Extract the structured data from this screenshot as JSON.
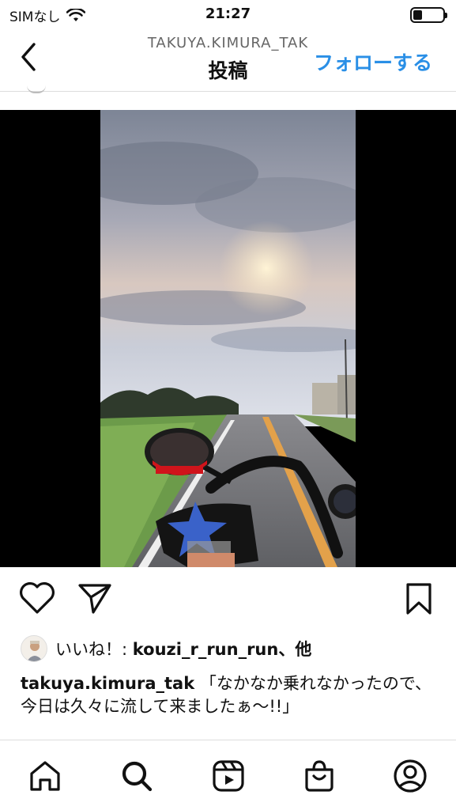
{
  "status_bar": {
    "carrier": "SIMなし",
    "time": "21:27",
    "battery_level": 0.3
  },
  "header": {
    "username": "TAKUYA.KIMURA_TAK",
    "title": "投稿",
    "follow_label": "フォローする"
  },
  "likes": {
    "prefix": "いいね！: ",
    "user": "kouzi_r_run_run",
    "suffix": "、他"
  },
  "caption": {
    "user": "takuya.kimura_tak",
    "text": " 「なかなか乗れなかったので、今日は久々に流して来ましたぁ〜!!」"
  },
  "icons": {
    "back": "chevron-left-icon",
    "like": "heart-icon",
    "share": "paper-plane-icon",
    "save": "bookmark-icon",
    "home": "home-icon",
    "search": "search-icon",
    "reels": "reels-icon",
    "shop": "shopping-bag-icon",
    "profile": "profile-icon"
  },
  "colors": {
    "accent": "#2a8fe6"
  }
}
